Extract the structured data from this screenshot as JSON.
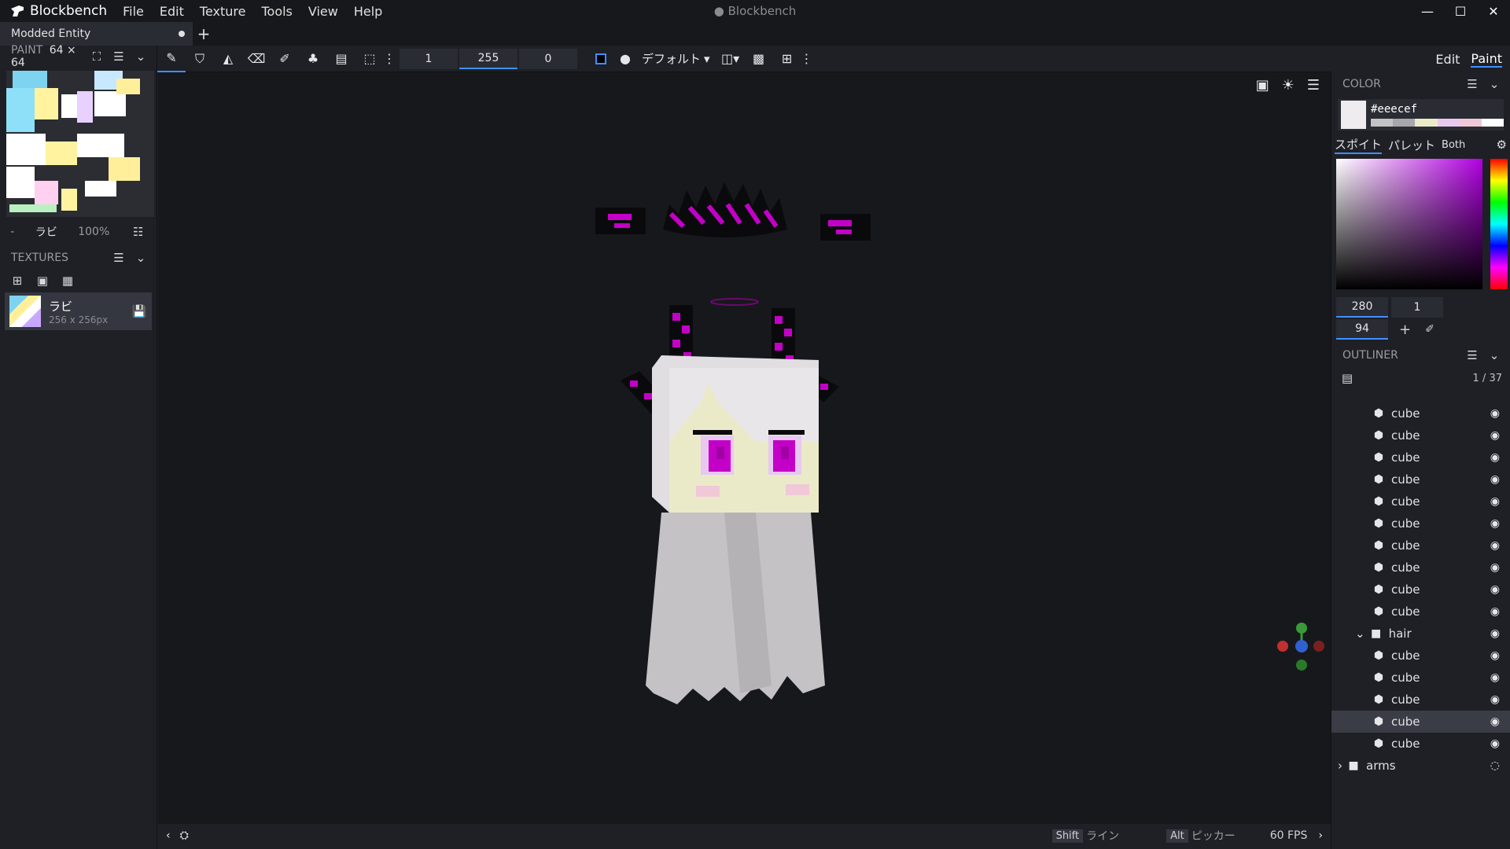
{
  "app": {
    "name": "Blockbench",
    "window_title": "● Blockbench",
    "menu": [
      "File",
      "Edit",
      "Texture",
      "Tools",
      "View",
      "Help"
    ]
  },
  "tabs": [
    {
      "label": "Modded Entity"
    }
  ],
  "left": {
    "paint_label": "PAINT",
    "paint_size": "64 × 64",
    "uv_prev": "-",
    "uv_name": "ラビ",
    "uv_zoom": "100%",
    "textures_label": "TEXTURES",
    "texture": {
      "name": "ラビ",
      "size": "256 x 256px"
    }
  },
  "toolbar": {
    "brush_size": "1",
    "opacity": "255",
    "softness": "0",
    "blend_mode": "デフォルト"
  },
  "modes": [
    "Edit",
    "Paint"
  ],
  "color_panel": {
    "label": "COLOR",
    "hex": "#eeecef",
    "subtabs": [
      "スポイト",
      "パレット",
      "Both"
    ],
    "h": "280",
    "s": "1",
    "v": "94"
  },
  "outliner": {
    "label": "OUTLINER",
    "count": "1 / 37",
    "items": [
      {
        "type": "cube",
        "label": "cube",
        "indent": 2
      },
      {
        "type": "cube",
        "label": "cube",
        "indent": 2
      },
      {
        "type": "cube",
        "label": "cube",
        "indent": 2
      },
      {
        "type": "cube",
        "label": "cube",
        "indent": 2
      },
      {
        "type": "cube",
        "label": "cube",
        "indent": 2
      },
      {
        "type": "cube",
        "label": "cube",
        "indent": 2
      },
      {
        "type": "cube",
        "label": "cube",
        "indent": 2
      },
      {
        "type": "cube",
        "label": "cube",
        "indent": 2
      },
      {
        "type": "cube",
        "label": "cube",
        "indent": 2
      },
      {
        "type": "cube",
        "label": "cube",
        "indent": 2
      },
      {
        "type": "group",
        "label": "hair",
        "indent": 1,
        "expanded": true
      },
      {
        "type": "cube",
        "label": "cube",
        "indent": 2
      },
      {
        "type": "cube",
        "label": "cube",
        "indent": 2
      },
      {
        "type": "cube",
        "label": "cube",
        "indent": 2
      },
      {
        "type": "cube",
        "label": "cube",
        "indent": 2,
        "selected": true
      },
      {
        "type": "cube",
        "label": "cube",
        "indent": 2
      },
      {
        "type": "group",
        "label": "arms",
        "indent": 0,
        "expanded": false,
        "hidden": true
      }
    ]
  },
  "status": {
    "shift_key": "Shift",
    "shift_action": "ライン",
    "alt_key": "Alt",
    "alt_action": "ピッカー",
    "fps": "60 FPS"
  }
}
